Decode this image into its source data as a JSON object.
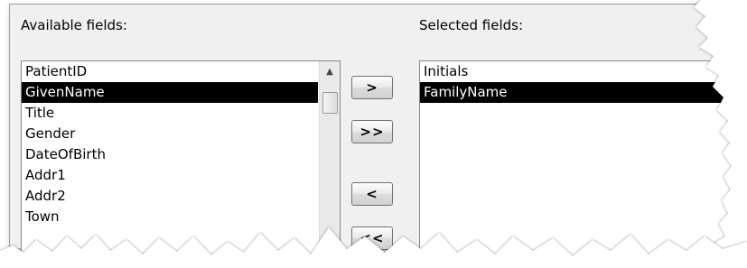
{
  "available": {
    "label": "Available fields:",
    "items": [
      "PatientID",
      "GivenName",
      "Title",
      "Gender",
      "DateOfBirth",
      "Addr1",
      "Addr2",
      "Town"
    ],
    "selected_item": "GivenName"
  },
  "selected": {
    "label": "Selected fields:",
    "items": [
      "Initials",
      "FamilyName"
    ],
    "selected_item": "FamilyName"
  },
  "buttons": {
    "add": ">",
    "add_all": ">>",
    "remove": "<",
    "remove_all": "<<"
  },
  "scrollbar": {
    "up_arrow": "▲"
  },
  "colors": {
    "selection_bg": "#000000",
    "selection_fg": "#ffffff",
    "dialog_bg": "#f0f0f0"
  }
}
